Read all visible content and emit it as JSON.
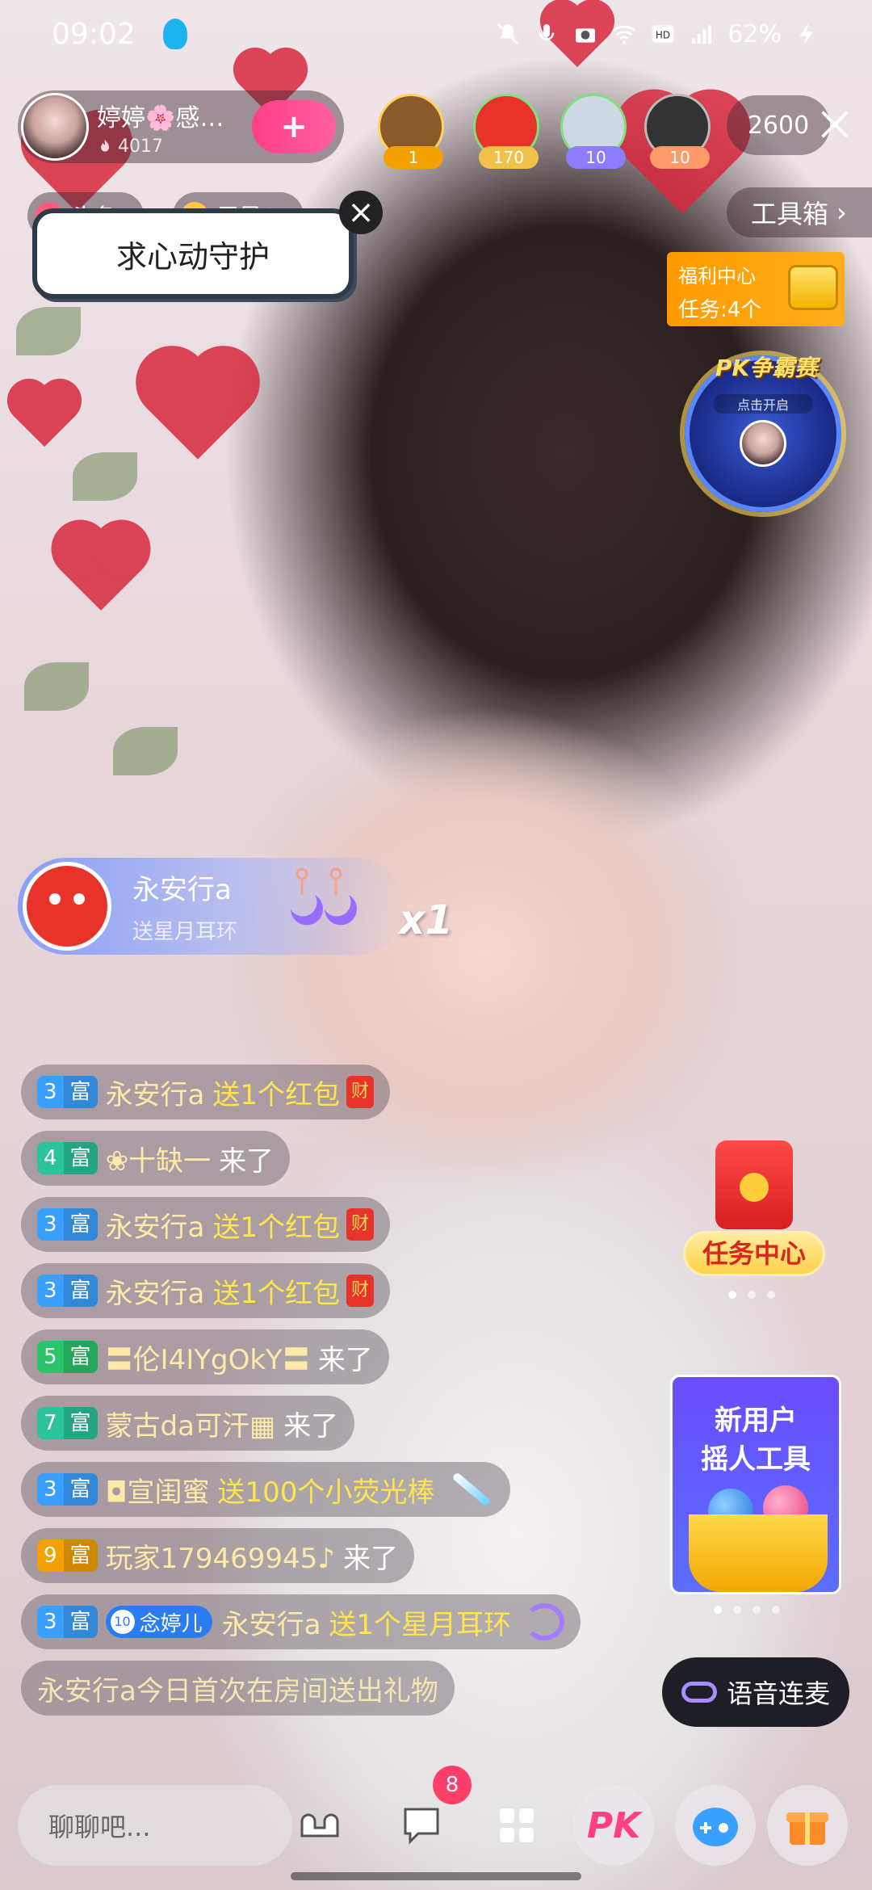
{
  "status_bar": {
    "time": "09:02",
    "battery": "62%"
  },
  "host": {
    "name": "婷婷🌸感…",
    "likes": "4017",
    "follow_label": "+"
  },
  "viewers": [
    {
      "badge": "1",
      "badge_color": "#f2a100",
      "avatar_color": "#8a5a2a"
    },
    {
      "badge": "170",
      "badge_color": "#f2c14a",
      "avatar_color": "#e8332b"
    },
    {
      "badge": "10",
      "badge_color": "#8c7cff",
      "avatar_color": "#cfd7e4"
    },
    {
      "badge": "10",
      "badge_color": "#ff9a6a",
      "avatar_color": "#333333"
    }
  ],
  "viewer_count": "2600",
  "rank_chips": {
    "headline": "头条7",
    "weekly_star": "周星65"
  },
  "guard_banner": "求心动守护",
  "toolbox_label": "工具箱",
  "welfare": {
    "title": "福利中心",
    "tasks": "任务:4个"
  },
  "pk": {
    "title": "PK争霸赛",
    "subtitle": "点击开启"
  },
  "gift_toast": {
    "user": "永安行a",
    "action": "送星月耳环",
    "multiplier": "x1"
  },
  "chat": [
    {
      "level": "3",
      "tag": "富",
      "color": "#3aa0ff",
      "user": "永安行a",
      "text": "送1个红包",
      "kind": "gift",
      "icon": "财"
    },
    {
      "level": "4",
      "tag": "富",
      "color": "#2bc49a",
      "user": "❀十缺一",
      "text": "来了",
      "kind": "come"
    },
    {
      "level": "3",
      "tag": "富",
      "color": "#3aa0ff",
      "user": "永安行a",
      "text": "送1个红包",
      "kind": "gift",
      "icon": "财"
    },
    {
      "level": "3",
      "tag": "富",
      "color": "#3aa0ff",
      "user": "永安行a",
      "text": "送1个红包",
      "kind": "gift",
      "icon": "财"
    },
    {
      "level": "5",
      "tag": "富",
      "color": "#2bc46a",
      "user": "〓伦I4IYgOkY〓",
      "text": "来了",
      "kind": "come"
    },
    {
      "level": "7",
      "tag": "富",
      "color": "#2bc49a",
      "user": "蒙古da可汗▦",
      "text": "来了",
      "kind": "come"
    },
    {
      "level": "3",
      "tag": "富",
      "color": "#3aa0ff",
      "user": "◘宣闺蜜",
      "text": "送100个小荧光棒",
      "kind": "gift-stick"
    },
    {
      "level": "9",
      "tag": "富",
      "color": "#f2a100",
      "user": "玩家179469945♪",
      "text": "来了",
      "kind": "come"
    },
    {
      "level": "3",
      "tag": "富",
      "color": "#3aa0ff",
      "fan_badge": "念婷儿",
      "fan_level": "10",
      "user": "永安行a",
      "text": "送1个星月耳环",
      "kind": "gift-earring"
    }
  ],
  "system_message": "永安行a今日首次在房间送出礼物",
  "task_center_label": "任务中心",
  "new_user": {
    "line1": "新用户",
    "line2": "摇人工具"
  },
  "voice_link_label": "语音连麦",
  "bottom": {
    "input_placeholder": "聊聊吧...",
    "message_badge": "8",
    "pk_label": "PK"
  }
}
